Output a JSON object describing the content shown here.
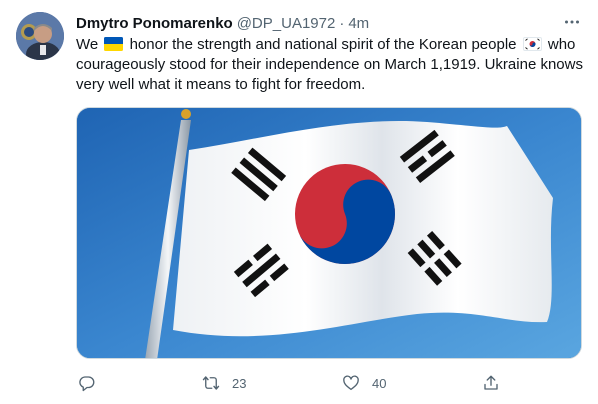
{
  "tweet": {
    "author_name": "Dmytro Ponomarenko",
    "author_handle": "@DP_UA1972",
    "separator": "·",
    "time": "4m",
    "text_parts": {
      "p1": "We",
      "p2": " honor the strength and national spirit of the Korean people",
      "p3": " who courageously stood for their independence on March 1,1919. Ukraine knows very well what it means to fight for freedom."
    },
    "emojis": [
      "ukraine-flag-emoji",
      "south-korea-flag-emoji"
    ],
    "media": {
      "description_icon": "south-korea-flag-image"
    },
    "actions": {
      "reply_count": "",
      "retweet_count": "23",
      "like_count": "40",
      "share_count": ""
    }
  },
  "icons": [
    "more-icon",
    "reply-icon",
    "retweet-icon",
    "like-icon",
    "share-icon"
  ],
  "colors": {
    "text_primary": "#0f1419",
    "text_secondary": "#536471",
    "border": "#cfd9de",
    "sky": "#2a75c0",
    "flag_red": "#cd2e3a",
    "flag_blue": "#0047a0"
  }
}
